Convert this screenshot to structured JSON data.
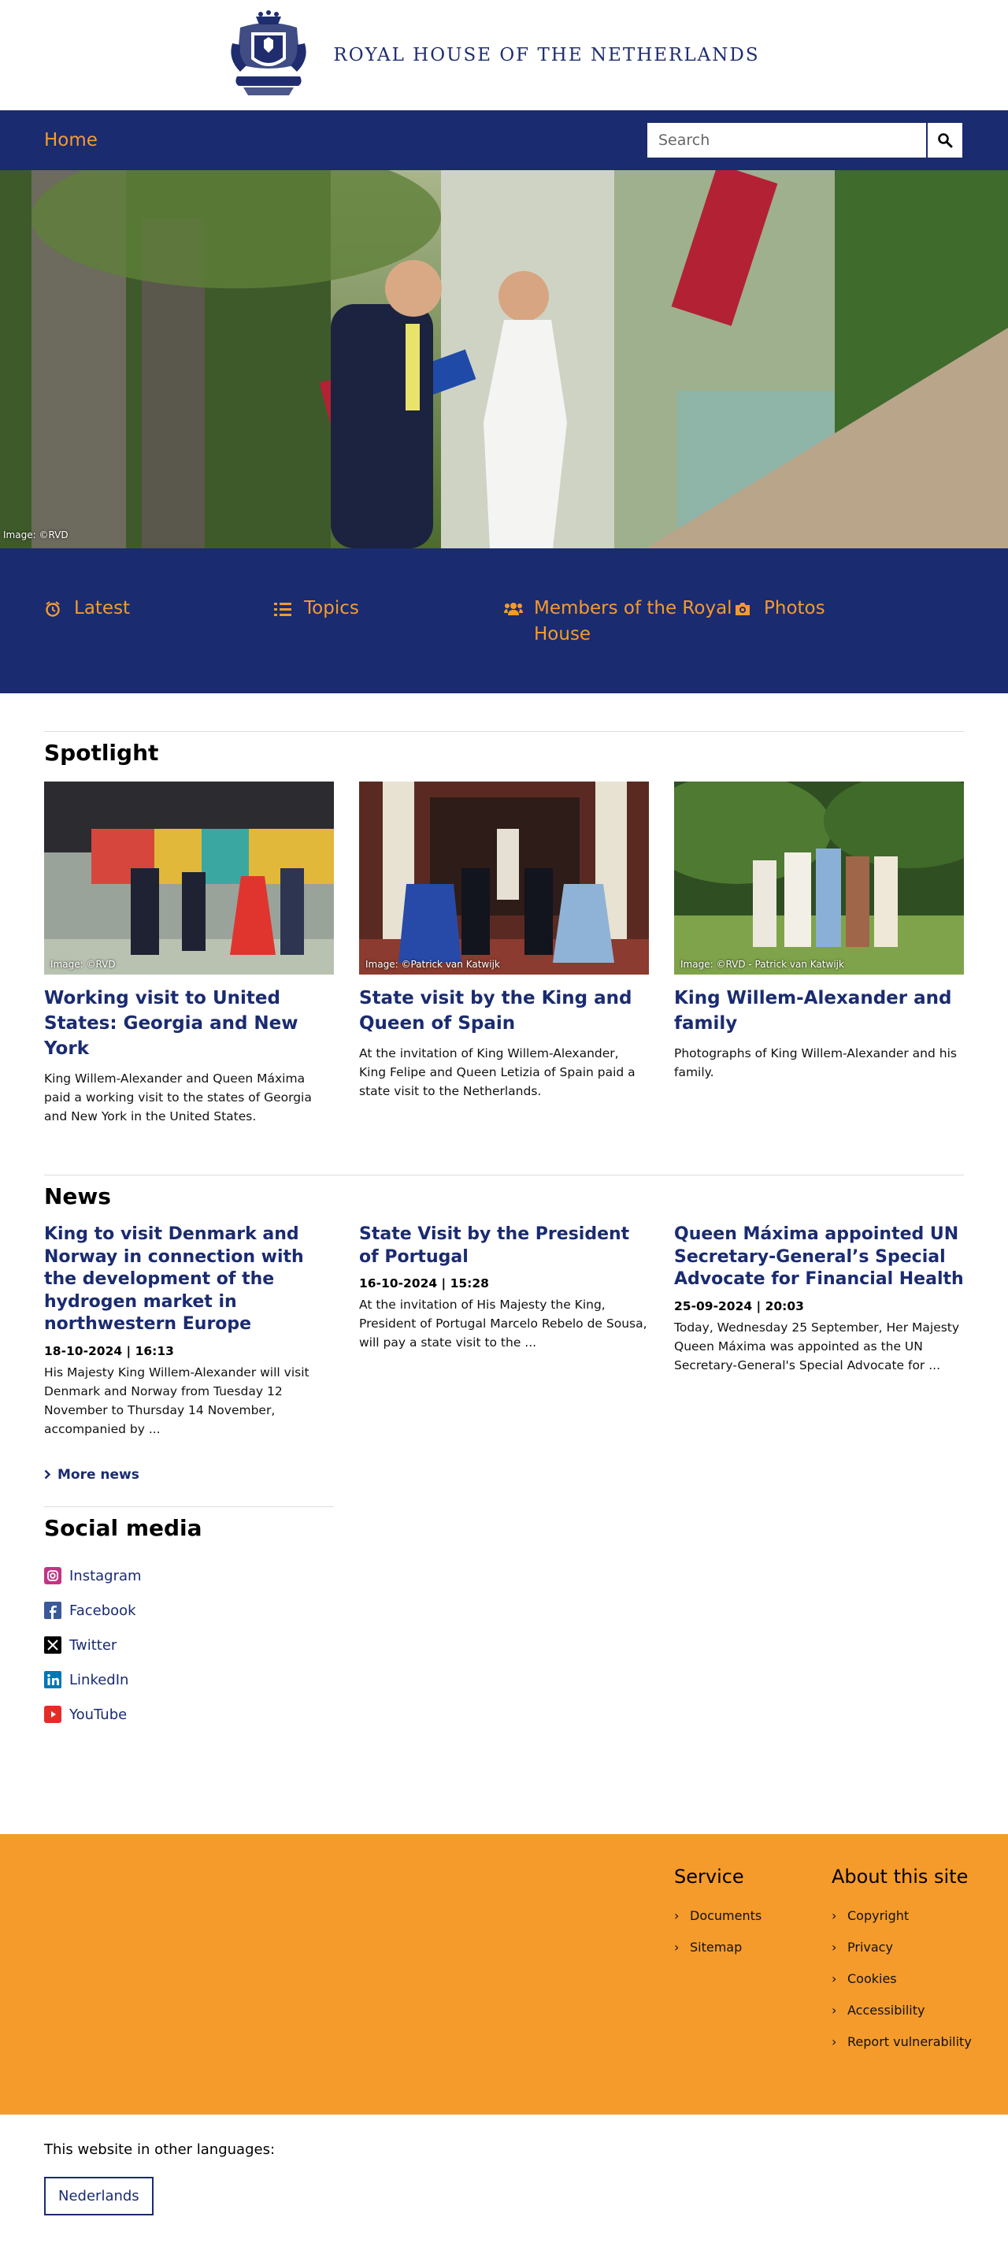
{
  "header": {
    "site_name": "ROYAL HOUSE OF THE NETHERLANDS"
  },
  "nav": {
    "home": "Home",
    "search_placeholder": "Search"
  },
  "hero": {
    "credit": "Image: ©RVD"
  },
  "quicklinks": [
    {
      "label": "Latest",
      "icon": "alarm-clock-icon"
    },
    {
      "label": "Topics",
      "icon": "list-icon"
    },
    {
      "label": "Members of the Royal House",
      "icon": "group-icon"
    },
    {
      "label": "Photos",
      "icon": "camera-icon"
    }
  ],
  "spotlight": {
    "title": "Spotlight",
    "cards": [
      {
        "credit": "Image: ©RVD",
        "title": "Working visit to United States: Georgia and New York",
        "text": "King Willem-Alexander and Queen Máxima paid a working visit to the states of Georgia and New York in the United States."
      },
      {
        "credit": "Image: ©Patrick van Katwijk",
        "title": "State visit by the King and Queen of Spain",
        "text": "At the invitation of King Willem-Alexander, King Felipe and Queen Letizia of Spain paid a state visit to the Netherlands."
      },
      {
        "credit": "Image: ©RVD - Patrick van Katwijk",
        "title": "King Willem-Alexander and family",
        "text": "Photographs of King Willem-Alexander and his family."
      }
    ]
  },
  "news": {
    "title": "News",
    "items": [
      {
        "title": "King to visit Denmark and Norway in connection with the development of the hydrogen market in northwestern Europe",
        "date": "18-10-2024 | 16:13",
        "text": "His Majesty King Willem-Alexander will visit Denmark and Norway from Tuesday 12 November to Thursday 14 November, accompanied by ..."
      },
      {
        "title": "State Visit by the President of Portugal",
        "date": "16-10-2024 | 15:28",
        "text": "At the invitation of His Majesty the King, President of Portugal Marcelo Rebelo de Sousa, will pay a state visit to the ..."
      },
      {
        "title": "Queen Máxima appointed UN Secretary-General’s Special Advocate for Financial Health",
        "date": "25-09-2024 | 20:03",
        "text": "Today, Wednesday 25 September, Her Majesty Queen Máxima was appointed as the UN Secretary-General's Special Advocate for ..."
      }
    ],
    "more": "More news"
  },
  "social": {
    "title": "Social media",
    "items": [
      {
        "label": "Instagram",
        "icon": "instagram-icon",
        "color": "#c13584"
      },
      {
        "label": "Facebook",
        "icon": "facebook-icon",
        "color": "#3b5998"
      },
      {
        "label": "Twitter",
        "icon": "x-twitter-icon",
        "color": "#000000"
      },
      {
        "label": "LinkedIn",
        "icon": "linkedin-icon",
        "color": "#0077b5"
      },
      {
        "label": "YouTube",
        "icon": "youtube-icon",
        "color": "#e52d27"
      }
    ]
  },
  "footer": {
    "service": {
      "title": "Service",
      "links": [
        "Documents",
        "Sitemap"
      ]
    },
    "about": {
      "title": "About this site",
      "links": [
        "Copyright",
        "Privacy",
        "Cookies",
        "Accessibility",
        "Report vulnerability"
      ]
    }
  },
  "languages": {
    "label": "This website in other languages:",
    "options": [
      "Nederlands"
    ]
  },
  "colors": {
    "brand_blue": "#1a2b70",
    "accent_orange": "#f59b2c"
  }
}
